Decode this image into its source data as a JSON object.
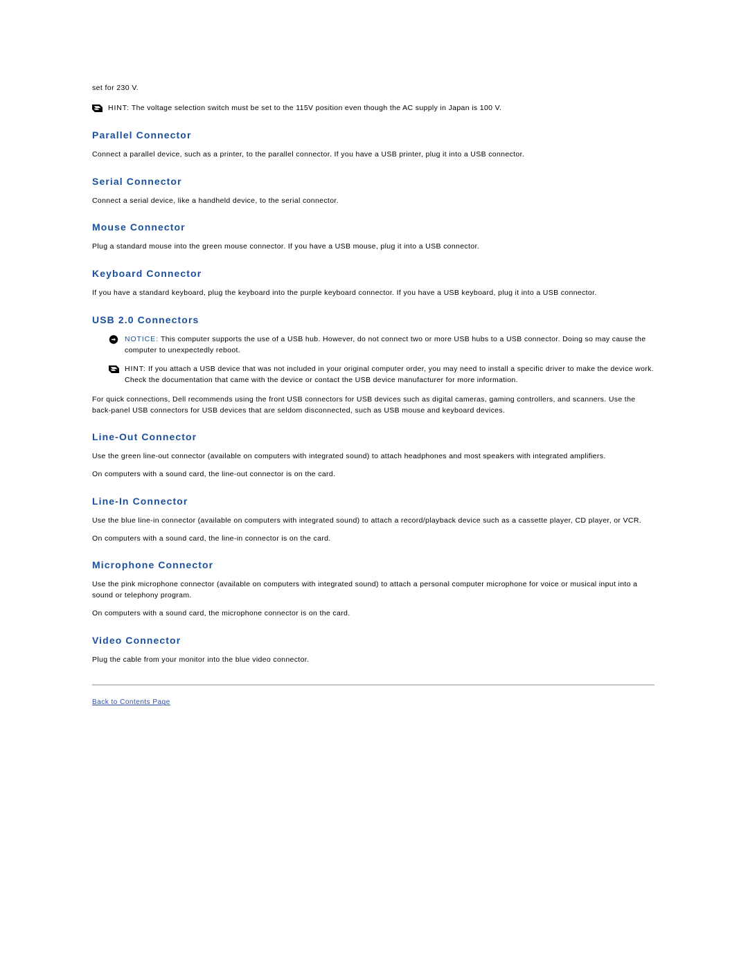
{
  "document": {
    "lead_text": "set for 230 V.",
    "top_hint": {
      "icon": "hint-icon",
      "label": "HINT:",
      "text": " The voltage selection switch must be set to the 115V position even though the AC supply in Japan is 100 V."
    },
    "sections": [
      {
        "heading": "Parallel Connector",
        "paragraphs": [
          "Connect a parallel device, such as a printer, to the parallel connector. If you have a USB printer, plug it into a USB connector."
        ]
      },
      {
        "heading": "Serial Connector",
        "paragraphs": [
          "Connect a serial device, like a handheld device, to the serial connector."
        ]
      },
      {
        "heading": "Mouse Connector",
        "paragraphs": [
          "Plug a standard mouse into the green mouse connector. If you have a USB mouse, plug it into a USB connector."
        ]
      },
      {
        "heading": "Keyboard Connector",
        "paragraphs": [
          "If you have a standard keyboard, plug the keyboard into the purple keyboard connector. If you have a USB keyboard, plug it into a USB connector."
        ]
      }
    ],
    "usb_section": {
      "heading": "USB 2.0 Connectors",
      "notice": {
        "icon": "notice-icon",
        "label": "NOTICE:",
        "text": " This computer supports the use of a USB hub. However, do not connect two or more USB hubs to a USB connector. Doing so may cause the computer to unexpectedly reboot."
      },
      "hint": {
        "icon": "hint-icon",
        "label": "HINT:",
        "text": " If you attach a USB device that was not included in your original computer order, you may need to install a specific driver to make the device work. Check the documentation that came with the device or contact the USB device manufacturer for more information."
      },
      "paragraph": "For quick connections, Dell recommends using the front USB connectors for USB devices such as digital cameras, gaming controllers, and scanners. Use the back-panel USB connectors for USB devices that are seldom disconnected, such as USB mouse and keyboard devices."
    },
    "sections2": [
      {
        "heading": "Line-Out Connector",
        "paragraphs": [
          "Use the green line-out connector (available on computers with integrated sound) to attach headphones and most speakers with integrated amplifiers.",
          "On computers with a sound card, the line-out connector is on the card."
        ]
      },
      {
        "heading": "Line-In Connector",
        "paragraphs": [
          "Use the blue line-in connector (available on computers with integrated sound) to attach a record/playback device such as a cassette player, CD player, or VCR.",
          "On computers with a sound card, the line-in connector is on the card."
        ]
      },
      {
        "heading": "Microphone Connector",
        "paragraphs": [
          "Use the pink microphone connector (available on computers with integrated sound) to attach a personal computer microphone for voice or musical input into a sound or telephony program.",
          "On computers with a sound card, the microphone connector is on the card."
        ]
      },
      {
        "heading": "Video Connector",
        "paragraphs": [
          "Plug the cable from your monitor into the blue video connector."
        ]
      }
    ],
    "footer": {
      "back_link": "Back to Contents Page"
    },
    "colors": {
      "heading": "#1a4f9c",
      "link": "#2b4fa0",
      "notice_label": "#1d4f91"
    }
  }
}
